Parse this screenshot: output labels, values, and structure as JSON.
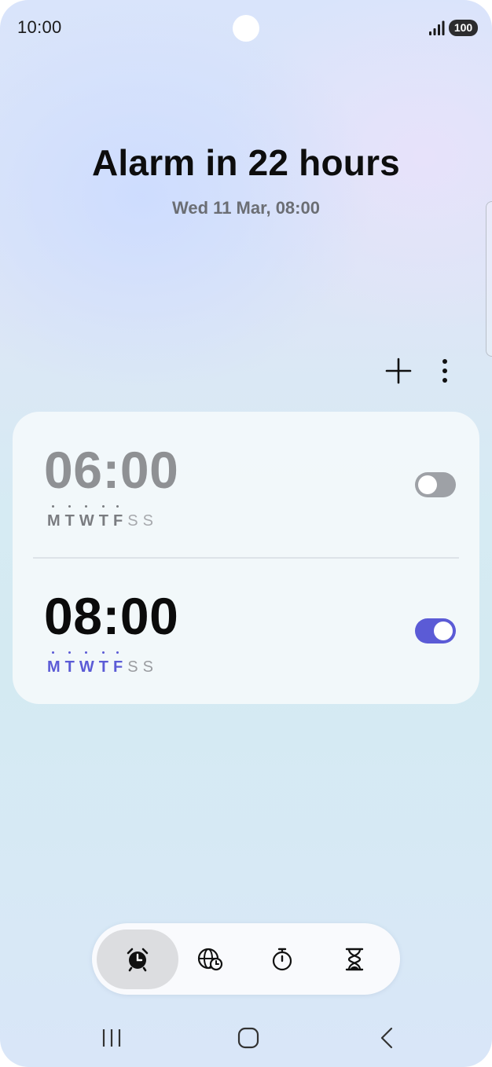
{
  "status_bar": {
    "time": "10:00",
    "battery": "100"
  },
  "header": {
    "title": "Alarm in 22 hours",
    "subtitle": "Wed 11 Mar, 08:00"
  },
  "actions": {
    "add_icon": "plus-icon",
    "more_icon": "more-vertical-icon"
  },
  "alarms": [
    {
      "time": "06:00",
      "enabled": false,
      "days": [
        {
          "label": "M",
          "active": true
        },
        {
          "label": "T",
          "active": true
        },
        {
          "label": "W",
          "active": true
        },
        {
          "label": "T",
          "active": true
        },
        {
          "label": "F",
          "active": true
        },
        {
          "label": "S",
          "active": false
        },
        {
          "label": "S",
          "active": false
        }
      ]
    },
    {
      "time": "08:00",
      "enabled": true,
      "days": [
        {
          "label": "M",
          "active": true
        },
        {
          "label": "T",
          "active": true
        },
        {
          "label": "W",
          "active": true
        },
        {
          "label": "T",
          "active": true
        },
        {
          "label": "F",
          "active": true
        },
        {
          "label": "S",
          "active": false
        },
        {
          "label": "S",
          "active": false
        }
      ]
    }
  ],
  "tabs": [
    {
      "icon": "alarm-clock-icon",
      "active": true
    },
    {
      "icon": "world-clock-icon",
      "active": false
    },
    {
      "icon": "stopwatch-icon",
      "active": false
    },
    {
      "icon": "timer-hourglass-icon",
      "active": false
    }
  ],
  "nav": {
    "recents_icon": "recents-icon",
    "home_icon": "home-icon",
    "back_icon": "back-icon"
  },
  "colors": {
    "accent": "#5b5bd6",
    "toggle_off": "#9ea1a6",
    "inactive_time": "#8f9194"
  }
}
